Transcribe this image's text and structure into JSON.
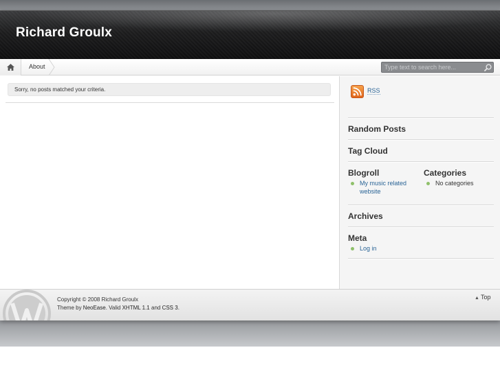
{
  "header": {
    "site_title": "Richard Groulx"
  },
  "nav": {
    "home_icon": "home-icon",
    "items": [
      {
        "label": "About"
      }
    ],
    "search": {
      "placeholder": "Type text to search here...",
      "icon": "search-icon"
    }
  },
  "main": {
    "notice": "Sorry, no posts matched your criteria."
  },
  "sidebar": {
    "rss": {
      "label": "RSS",
      "icon": "rss-icon"
    },
    "random_posts": {
      "title": "Random Posts"
    },
    "tag_cloud": {
      "title": "Tag Cloud"
    },
    "blogroll": {
      "title": "Blogroll",
      "items": [
        {
          "line1": "My music related",
          "line2": "website"
        }
      ]
    },
    "categories": {
      "title": "Categories",
      "items": [
        {
          "label": "No categories"
        }
      ]
    },
    "archives": {
      "title": "Archives"
    },
    "meta": {
      "title": "Meta",
      "items": [
        {
          "label": "Log in"
        }
      ]
    }
  },
  "footer": {
    "copyright": "Copyright © 2008 Richard Groulx",
    "theme_prefix": "Theme by ",
    "theme_link": "NeoEase",
    "valid_text": ". Valid ",
    "xhtml_link": "XHTML 1.1",
    "and_text": " and ",
    "css_link": "CSS 3",
    "end_text": ".",
    "top_label": "Top",
    "logo": "wordpress-logo"
  },
  "colors": {
    "link": "#2a6496",
    "bullet": "#8fc06a",
    "rss_orange": "#e8742a",
    "header_dark": "#1c1c1d"
  }
}
